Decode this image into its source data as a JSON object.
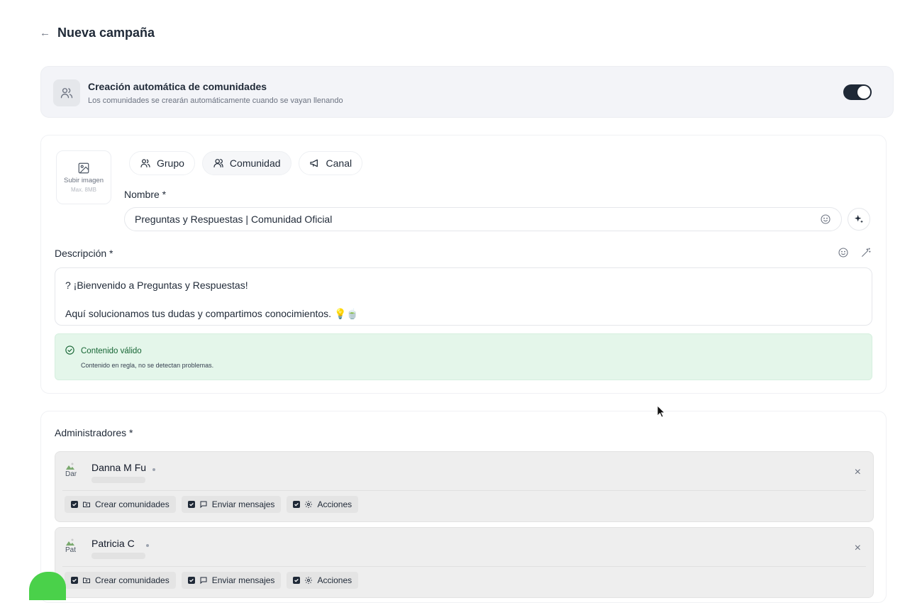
{
  "header": {
    "back_symbol": "←",
    "title": "Nueva campaña"
  },
  "auto_creation": {
    "title": "Creación automática de comunidades",
    "subtitle": "Los comunidades se crearán automáticamente cuando se vayan llenando",
    "enabled": true,
    "icon": "users-icon"
  },
  "upload": {
    "label": "Subir imagen",
    "max": "Max. 8MB",
    "icon": "image-icon"
  },
  "type_tabs": [
    {
      "label": "Grupo",
      "icon": "users-icon"
    },
    {
      "label": "Comunidad",
      "icon": "user-group-icon",
      "selected": true
    },
    {
      "label": "Canal",
      "icon": "megaphone-icon"
    }
  ],
  "name_field": {
    "label": "Nombre *",
    "value": "Preguntas y Respuestas | Comunidad Oficial"
  },
  "description_field": {
    "label": "Descripción *",
    "line1": "? ¡Bienvenido a Preguntas y Respuestas!",
    "line2": "Aquí solucionamos tus dudas y compartimos conocimientos. 💡🍵"
  },
  "validation": {
    "title": "Contenido válido",
    "subtitle": "Contenido en regla, no se detectan problemas.",
    "color": "#e4f6ea"
  },
  "admins": {
    "label": "Administradores *",
    "items": [
      {
        "name": "Danna M Fu",
        "avatar_alt": "Dar",
        "permissions": [
          "Crear comunidades",
          "Enviar mensajes",
          "Acciones"
        ]
      },
      {
        "name": "Patricia C",
        "avatar_alt": "Pat",
        "permissions": [
          "Crear comunidades",
          "Enviar mensajes",
          "Acciones"
        ]
      }
    ],
    "remove_symbol": "×"
  }
}
